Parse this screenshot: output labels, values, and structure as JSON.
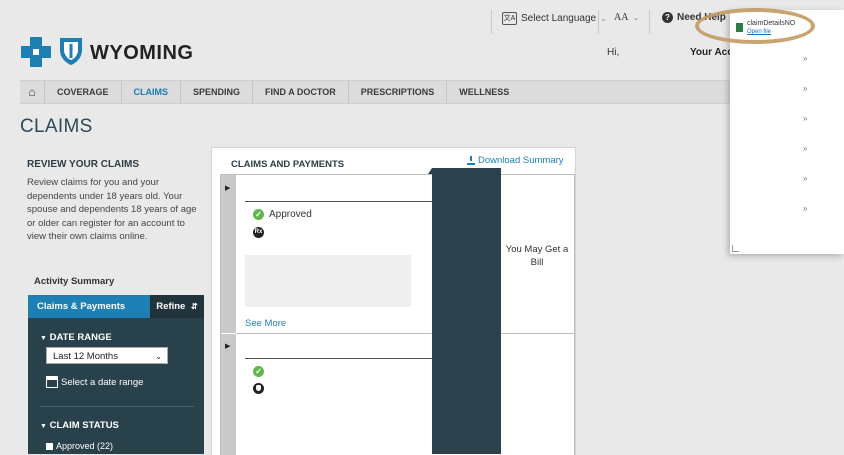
{
  "utility_bar": {
    "language_label": "Select Language",
    "text_size_label": "AA",
    "help_label": "Need Help"
  },
  "header": {
    "brand": "WYOMING",
    "greeting": "Hi,",
    "account_label": "Your Acc"
  },
  "nav": {
    "items": [
      {
        "label": "COVERAGE"
      },
      {
        "label": "CLAIMS"
      },
      {
        "label": "SPENDING"
      },
      {
        "label": "FIND A DOCTOR"
      },
      {
        "label": "PRESCRIPTIONS"
      },
      {
        "label": "WELLNESS"
      }
    ],
    "active": "CLAIMS"
  },
  "page_title": "CLAIMS",
  "sidebar": {
    "review_title": "REVIEW YOUR CLAIMS",
    "review_text": "Review claims for you and your dependents under 18 years old. Your spouse and dependents 18 years of age or older can register for an account to view their own claims online.",
    "activity_summary": "Activity Summary",
    "tab_label": "Claims & Payments",
    "refine_label": "Refine",
    "date_range_title": "DATE RANGE",
    "date_range_value": "Last 12 Months",
    "select_date_range": "Select a date range",
    "claim_status_title": "CLAIM STATUS",
    "status_options": [
      {
        "label": "Approved (22)"
      }
    ]
  },
  "main": {
    "card_title": "CLAIMS AND PAYMENTS",
    "download_label": "Download Summary",
    "rows": [
      {
        "status": "Approved",
        "see_more": "See More",
        "bill_text": "You May Get a Bill"
      },
      {
        "status": ""
      }
    ]
  },
  "download_popup": {
    "file_name": "claimDetailsNO",
    "open_label": "Open file"
  },
  "colors": {
    "accent": "#1d7fb3",
    "dark_panel": "#28414b",
    "approved": "#5fb84e",
    "highlight_ring": "#c29a63"
  }
}
